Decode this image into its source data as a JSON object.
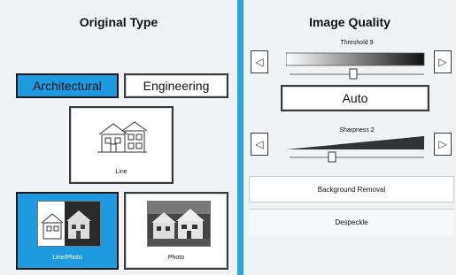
{
  "original_type": {
    "title": "Original Type",
    "architectural_label": "Architectural",
    "engineering_label": "Engineering",
    "line_label": "Line",
    "line_photo_label": "Line/Photo",
    "photo_label": "Photo",
    "selected": [
      "Architectural",
      "Line/Photo"
    ]
  },
  "image_quality": {
    "title": "Image Quality",
    "threshold_label": "Threshold 9",
    "threshold_value": 9,
    "auto_label": "Auto",
    "sharpness_label": "Sharpness 2",
    "sharpness_value": 2,
    "background_removal_label": "Background Removal",
    "despeckle_label": "Despeckle"
  },
  "icons": {
    "left_arrow": "◁",
    "right_arrow": "▷"
  },
  "colors": {
    "accent": "#1e9be0",
    "divider": "#2aa7e0"
  }
}
